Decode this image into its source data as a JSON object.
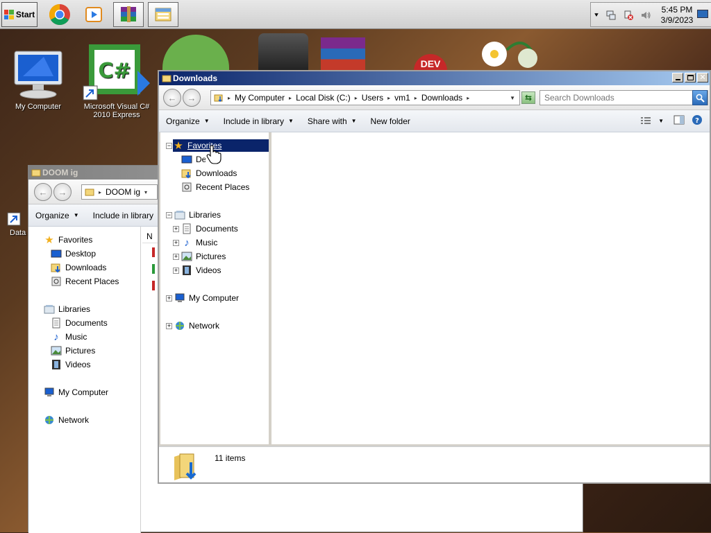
{
  "taskbar": {
    "start_label": "Start",
    "clock_time": "5:45 PM",
    "clock_date": "3/9/2023",
    "apps": [
      "chrome-icon",
      "media-player-icon",
      "winrar-icon",
      "explorer-icon"
    ]
  },
  "desktop": {
    "icons": [
      {
        "label": "My Computer"
      },
      {
        "label": "Microsoft Visual C#\n2010 Express"
      },
      {
        "label": "Data"
      }
    ]
  },
  "back_window": {
    "title": "DOOM ig",
    "crumb": "DOOM ig",
    "toolbar": {
      "organize": "Organize",
      "include": "Include in library"
    },
    "nav": {
      "favorites": "Favorites",
      "desktop": "Desktop",
      "downloads": "Downloads",
      "recent": "Recent Places",
      "libraries": "Libraries",
      "documents": "Documents",
      "music": "Music",
      "pictures": "Pictures",
      "videos": "Videos",
      "my_computer": "My Computer",
      "network": "Network"
    },
    "column_header_initial": "N"
  },
  "window": {
    "title": "Downloads",
    "breadcrumbs": [
      "My Computer",
      "Local Disk (C:)",
      "Users",
      "vm1",
      "Downloads"
    ],
    "search_placeholder": "Search Downloads",
    "toolbar": {
      "organize": "Organize",
      "include": "Include in library",
      "share": "Share with",
      "new_folder": "New folder"
    },
    "nav": {
      "favorites": "Favorites",
      "desktop": "Desktop",
      "downloads": "Downloads",
      "recent": "Recent Places",
      "libraries": "Libraries",
      "documents": "Documents",
      "music": "Music",
      "pictures": "Pictures",
      "videos": "Videos",
      "my_computer": "My Computer",
      "network": "Network"
    },
    "status": "11 items"
  },
  "colors": {
    "selection": "#0a246a",
    "titlebar_active_start": "#0a246a",
    "titlebar_active_end": "#a6caf0"
  }
}
